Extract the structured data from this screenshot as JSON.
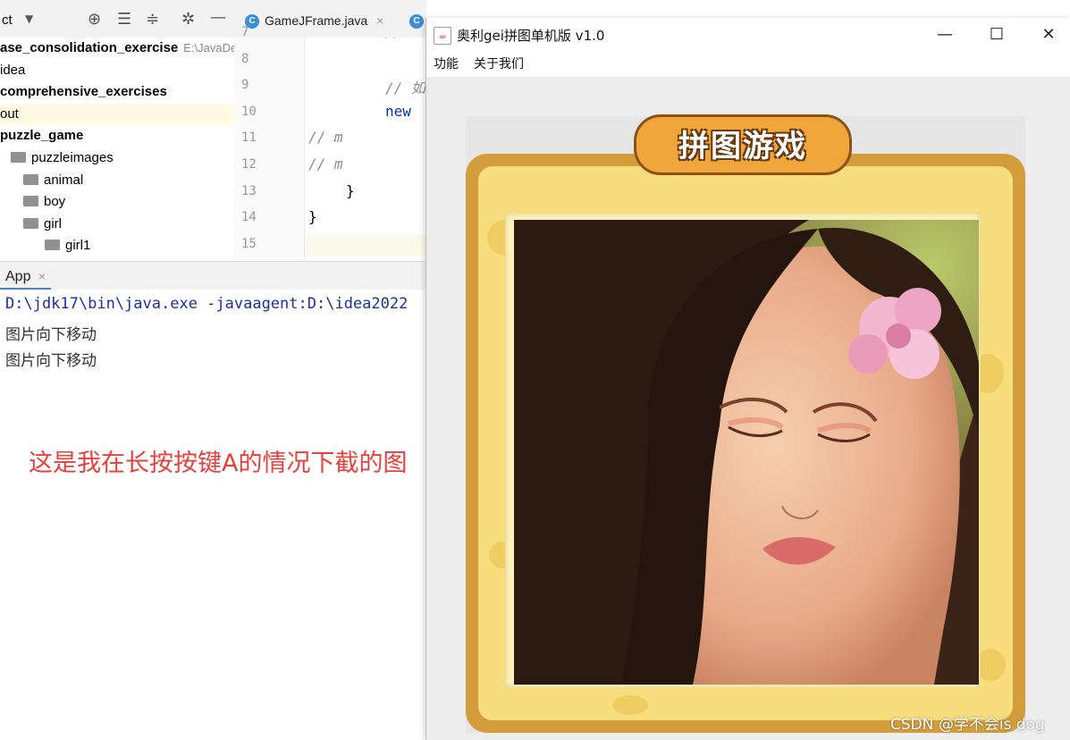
{
  "ide": {
    "toolbar": {
      "project_label": "ct"
    },
    "project_tree": [
      {
        "text": "ase_consolidation_exercise",
        "hint": "E:\\JavaDe",
        "bold": true
      },
      {
        "text": "idea",
        "hint": "",
        "bold": false
      },
      {
        "text": "comprehensive_exercises",
        "hint": "",
        "bold": true
      },
      {
        "text": "out",
        "hint": "",
        "bold": false,
        "selected": true
      },
      {
        "text": "puzzle_game",
        "hint": "",
        "bold": true
      },
      {
        "text": "puzzleimages",
        "hint": "",
        "bold": false,
        "folder": true
      },
      {
        "text": "animal",
        "hint": "",
        "bold": false,
        "folder": true
      },
      {
        "text": "boy",
        "hint": "",
        "bold": false,
        "folder": true
      },
      {
        "text": "girl",
        "hint": "",
        "bold": false,
        "folder": true
      },
      {
        "text": "girl1",
        "hint": "",
        "bold": false,
        "folder": true
      }
    ],
    "editor_tabs": [
      {
        "label": "GameJFrame.java",
        "close": "×"
      },
      {
        "label": "",
        "close": ""
      }
    ],
    "line_numbers": [
      "7",
      "8",
      "9",
      "10",
      "11",
      "12",
      "13",
      "14",
      "15"
    ],
    "code_lines": [
      {
        "text": "//",
        "cls": "cm",
        "indent": 90
      },
      {
        "text": "",
        "cls": "",
        "indent": 0
      },
      {
        "text": "// 如",
        "cls": "cm",
        "indent": 90
      },
      {
        "text": "new ",
        "cls": "kw",
        "indent": 90
      },
      {
        "text": "//      m",
        "cls": "cm",
        "indent": 4
      },
      {
        "text": "//      m",
        "cls": "cm",
        "indent": 4
      },
      {
        "text": "}",
        "cls": "",
        "indent": 46
      },
      {
        "text": "}",
        "cls": "",
        "indent": 4
      },
      {
        "text": "",
        "cls": "",
        "indent": 0
      }
    ],
    "run_tab": {
      "label": "App",
      "close": "×"
    },
    "console": {
      "command": "D:\\jdk17\\bin\\java.exe -javaagent:D:\\idea2022",
      "outputs": [
        "图片向下移动",
        "图片向下移动"
      ]
    },
    "annotation": "这是我在长按按键A的情况下截的图"
  },
  "java_window": {
    "title": "奥利gei拼图单机版 v1.0",
    "controls": {
      "minimize": "—",
      "maximize": "☐",
      "close": "✕"
    },
    "menus": [
      "功能",
      "关于我们"
    ],
    "game": {
      "sign_text": "拼图游戏"
    }
  },
  "watermark": "CSDN @学不会is dog",
  "colors": {
    "annotation": "#e8413b",
    "frame": "#d39d3c",
    "frame_inner": "#f7dd7b"
  }
}
